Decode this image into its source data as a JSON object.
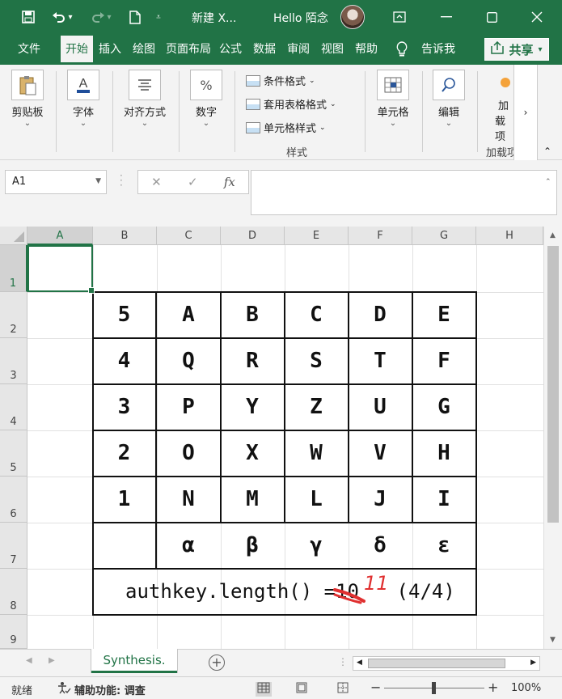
{
  "titlebar": {
    "filename": "新建 X...",
    "user": "Hello 陌念",
    "save_icon": "save-icon",
    "undo_icon": "undo-icon",
    "redo_icon": "redo-icon",
    "new_icon": "new-file-icon"
  },
  "tabs": [
    "文件",
    "开始",
    "插入",
    "绘图",
    "页面布局",
    "公式",
    "数据",
    "审阅",
    "视图",
    "帮助"
  ],
  "active_tab": "开始",
  "tell_me": "告诉我",
  "share": "共享",
  "ribbon": {
    "clipboard": "剪贴板",
    "font": "字体",
    "align": "对齐方式",
    "number": "数字",
    "cond_format": "条件格式",
    "table_format": "套用表格格式",
    "cell_style": "单元格样式",
    "styles_group": "样式",
    "cells": "单元格",
    "editing": "编辑",
    "addins_line1": "加",
    "addins_line2": "载项",
    "addins_group": "加载项",
    "number_symbol": "%"
  },
  "formula_bar": {
    "namebox": "A1",
    "fx": "fx",
    "value": ""
  },
  "columns": [
    "A",
    "B",
    "C",
    "D",
    "E",
    "F",
    "G",
    "H"
  ],
  "rows": [
    "1",
    "2",
    "3",
    "4",
    "5",
    "6",
    "7",
    "8",
    "9"
  ],
  "table": [
    [
      "5",
      "A",
      "B",
      "C",
      "D",
      "E"
    ],
    [
      "4",
      "Q",
      "R",
      "S",
      "T",
      "F"
    ],
    [
      "3",
      "P",
      "Y",
      "Z",
      "U",
      "G"
    ],
    [
      "2",
      "O",
      "X",
      "W",
      "V",
      "H"
    ],
    [
      "1",
      "N",
      "M",
      "L",
      "J",
      "I"
    ],
    [
      "",
      "α",
      "β",
      "γ",
      "δ",
      "ε"
    ]
  ],
  "formula_row": {
    "text": "authkey.length() = ",
    "struck": "10",
    "handwritten": "11",
    "progress": "(4/4)",
    "strike_color": "#e03030"
  },
  "sheet": {
    "tab": "Synthesis.",
    "add": "+"
  },
  "status": {
    "ready": "就绪",
    "accessibility": "辅助功能: 调查",
    "zoom": "100%"
  },
  "colors": {
    "brand": "#217346"
  }
}
